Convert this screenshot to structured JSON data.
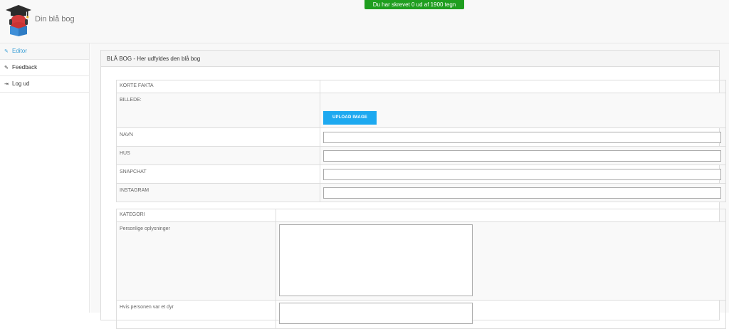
{
  "header": {
    "brand": "Din blå bog",
    "counter": "Du har skrevet 0 ud af 1900 tegn",
    "counter_color": "#1f9e1f"
  },
  "sidebar": {
    "items": [
      {
        "label": "Editor",
        "icon": "edit-icon",
        "active": true
      },
      {
        "label": "Feedback",
        "icon": "edit-icon",
        "active": false
      },
      {
        "label": "Log ud",
        "icon": "sign-out-icon",
        "active": false
      }
    ]
  },
  "panel": {
    "title": "BLÅ BOG - Her udfyldes den blå bog"
  },
  "facts": {
    "header": "KORTE FAKTA",
    "image_label": "BILLEDE:",
    "upload_label": "UPLOAD IMAGE",
    "fields": [
      {
        "label": "NAVN",
        "value": ""
      },
      {
        "label": "HUS",
        "value": ""
      },
      {
        "label": "SNAPCHAT",
        "value": ""
      },
      {
        "label": "INSTAGRAM",
        "value": ""
      }
    ]
  },
  "category": {
    "header": "KATEGORI",
    "rows": [
      {
        "label": "Personlige oplysninger",
        "value": ""
      },
      {
        "label": "Hvis personen var et dyr",
        "value": ""
      }
    ]
  },
  "colors": {
    "accent": "#1da9f0",
    "active_link": "#3a9fd6"
  }
}
